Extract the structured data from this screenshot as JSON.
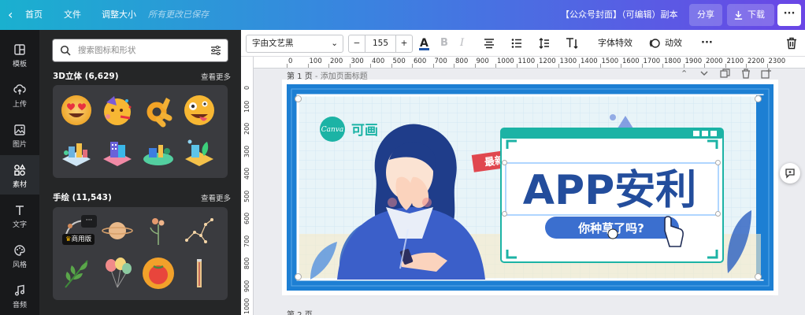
{
  "topbar": {
    "back_icon": "chevron-left-icon",
    "home": "首页",
    "file": "文件",
    "resize": "调整大小",
    "save_status": "所有更改已保存",
    "doc_title": "【公众号封面】（可编辑）副本",
    "share": "分享",
    "download": "下载",
    "more_icon": "more-horizontal-icon"
  },
  "rail": {
    "items": [
      {
        "label": "模板",
        "icon": "template-icon"
      },
      {
        "label": "上传",
        "icon": "upload-icon"
      },
      {
        "label": "图片",
        "icon": "image-icon"
      },
      {
        "label": "素材",
        "icon": "elements-icon"
      },
      {
        "label": "文字",
        "icon": "text-icon"
      },
      {
        "label": "风格",
        "icon": "style-icon"
      },
      {
        "label": "音频",
        "icon": "music-icon"
      }
    ]
  },
  "panel": {
    "search_placeholder": "搜索图标和形状",
    "section1": {
      "title": "3D立体 (6,629)",
      "more": "查看更多"
    },
    "section2": {
      "title": "手绘 (11,543)",
      "more": "查看更多"
    },
    "pro_badge": "商用版",
    "pro_more": "···"
  },
  "toolbar": {
    "font": "字由文艺黑",
    "font_size": "155",
    "minus": "−",
    "plus": "+",
    "color_letter": "A",
    "bold_letter": "B",
    "italic_letter": "I",
    "text_effects": "字体特效",
    "animate": "动效",
    "text_color": "#1f55a8"
  },
  "ruler": {
    "h_ticks": [
      "0",
      "100",
      "200",
      "300",
      "400",
      "500",
      "600",
      "700",
      "800",
      "900",
      "1000",
      "1100",
      "1200",
      "1300",
      "1400",
      "1500",
      "1600",
      "1700",
      "1800",
      "1900",
      "2000",
      "2100",
      "2200",
      "2300"
    ],
    "v_ticks": [
      "0",
      "100",
      "200",
      "300",
      "400",
      "500",
      "600",
      "700",
      "800",
      "900",
      "1000"
    ]
  },
  "canvas": {
    "page1_label": "第 1 页",
    "page1_add": " - 添加页面标题",
    "page2_label": "第 2 页",
    "logo_text": "Canva",
    "logo_cn": "可画",
    "tag": "最新",
    "headline": "APP安利",
    "subline": "你种草了吗?"
  },
  "colors": {
    "canvas_blue": "#1d7fd3",
    "headline_blue": "#234d9c",
    "teal": "#1cb3a5",
    "tag_red": "#e0474f"
  }
}
